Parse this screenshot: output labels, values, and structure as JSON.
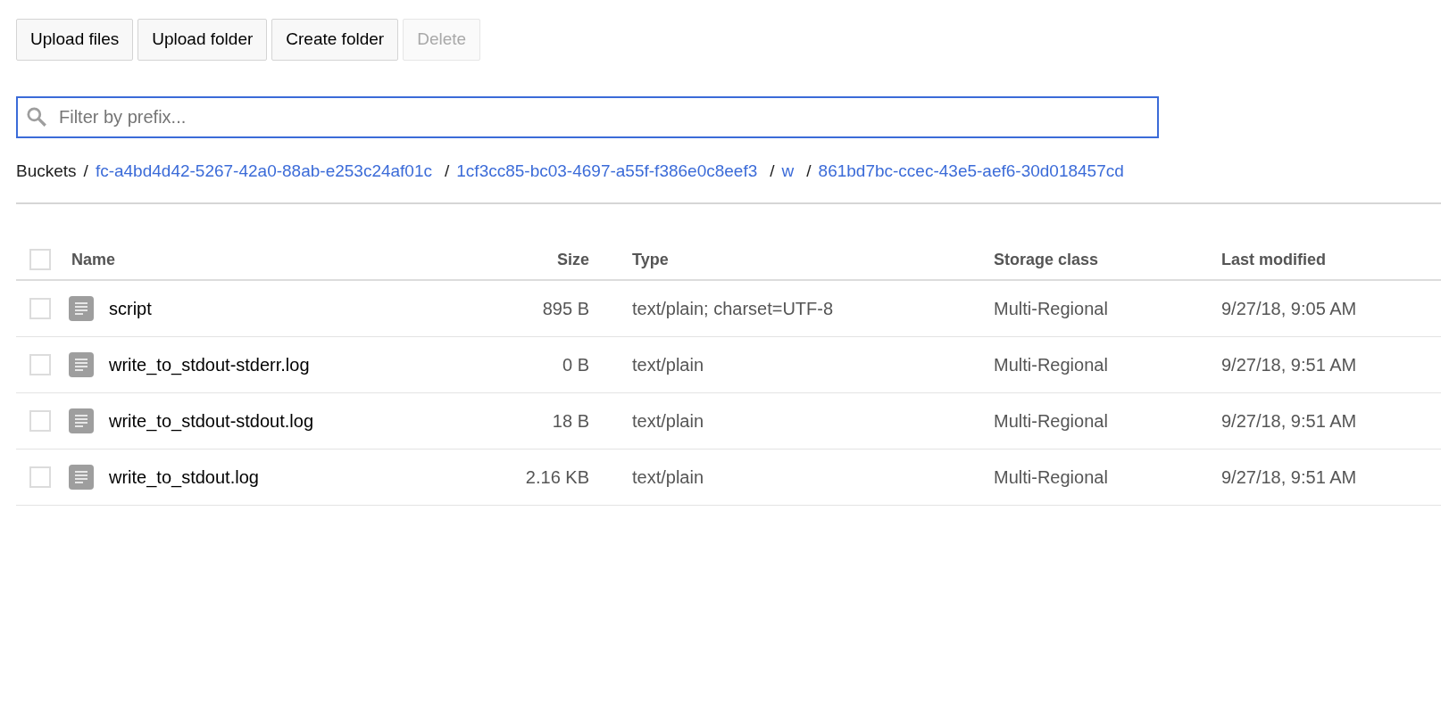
{
  "toolbar": [
    {
      "label": "Upload files",
      "disabled": false
    },
    {
      "label": "Upload folder",
      "disabled": false
    },
    {
      "label": "Create folder",
      "disabled": false
    },
    {
      "label": "Delete",
      "disabled": true
    }
  ],
  "search": {
    "placeholder": "Filter by prefix..."
  },
  "breadcrumb": {
    "root": "Buckets",
    "separator": "/",
    "items": [
      "fc-a4bd4d42-5267-42a0-88ab-e253c24af01c",
      "1cf3cc85-bc03-4697-a55f-f386e0c8eef3",
      "w",
      "861bd7bc-ccec-43e5-aef6-30d018457cd"
    ]
  },
  "table": {
    "select_all": {
      "checked": false
    },
    "columns": [
      "Name",
      "Size",
      "Type",
      "Storage class",
      "Last modified"
    ],
    "rows": [
      {
        "checked": false,
        "name": "script",
        "size": "895 B",
        "type": "text/plain; charset=UTF-8",
        "storage_class": "Multi-Regional",
        "last_modified": "9/27/18, 9:05 AM"
      },
      {
        "checked": false,
        "name": "write_to_stdout-stderr.log",
        "size": "0 B",
        "type": "text/plain",
        "storage_class": "Multi-Regional",
        "last_modified": "9/27/18, 9:51 AM"
      },
      {
        "checked": false,
        "name": "write_to_stdout-stdout.log",
        "size": "18 B",
        "type": "text/plain",
        "storage_class": "Multi-Regional",
        "last_modified": "9/27/18, 9:51 AM"
      },
      {
        "checked": false,
        "name": "write_to_stdout.log",
        "size": "2.16 KB",
        "type": "text/plain",
        "storage_class": "Multi-Regional",
        "last_modified": "9/27/18, 9:51 AM"
      }
    ]
  }
}
